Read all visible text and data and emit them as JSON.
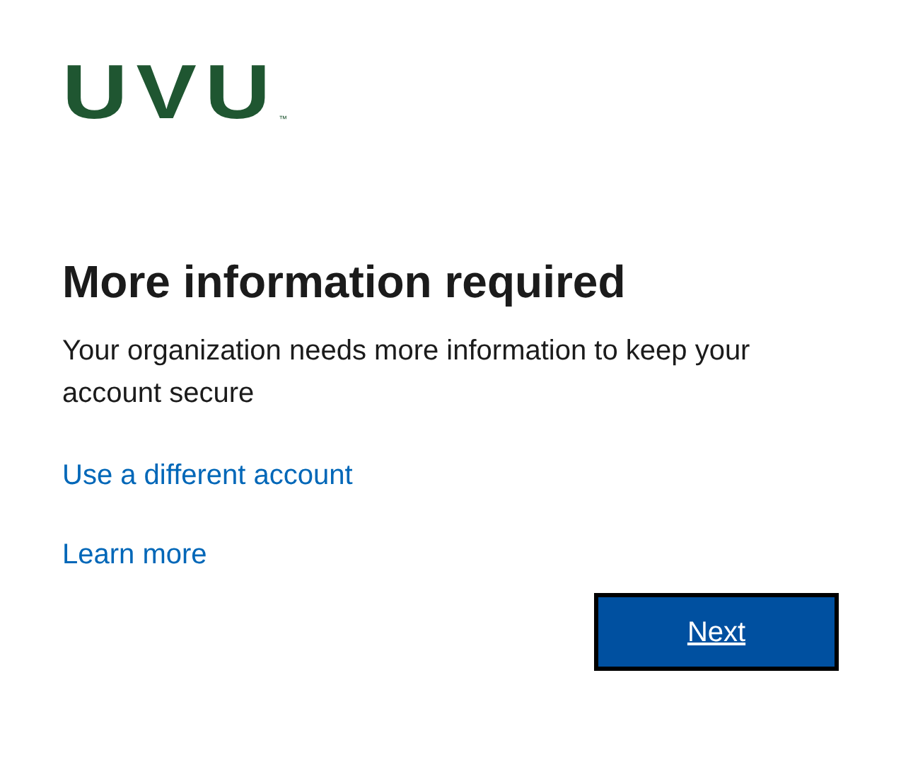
{
  "logo": {
    "text": "UVU",
    "mark": "™"
  },
  "title": "More information required",
  "description": "Your organization needs more information to keep your account secure",
  "links": [
    "Use a different account",
    "Learn more"
  ],
  "buttons": [
    {
      "label": "Next",
      "focused": true
    }
  ]
}
